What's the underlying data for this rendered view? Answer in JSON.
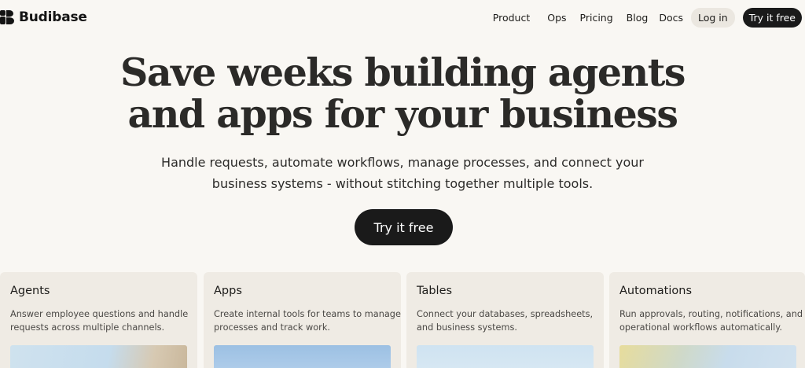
{
  "nav": {
    "brand": "Budibase",
    "brand_icon": "budibase-logo-icon",
    "links": {
      "product": "Product",
      "ops": "Ops",
      "pricing": "Pricing",
      "blog": "Blog",
      "docs": "Docs"
    },
    "login_label": "Log in",
    "try_label": "Try it free"
  },
  "hero": {
    "title_line1": "Save weeks building agents",
    "title_line2": "and apps for your business",
    "subtitle_line1": "Handle requests, automate workflows, manage processes, and connect your",
    "subtitle_line2": "business systems - without stitching together multiple tools.",
    "cta_label": "Try it free"
  },
  "cards": [
    {
      "title": "Agents",
      "desc_line1": "Answer employee questions and handle",
      "desc_line2": "requests across multiple channels."
    },
    {
      "title": "Apps",
      "desc_line1": "Create internal tools for teams to manage",
      "desc_line2": "processes and track work."
    },
    {
      "title": "Tables",
      "desc_line1": "Connect your databases, spreadsheets,",
      "desc_line2": "and business systems."
    },
    {
      "title": "Automations",
      "desc_line1": "Run approvals, routing, notifications, and",
      "desc_line2": "operational workflows automatically."
    }
  ],
  "colors": {
    "background": "#f9f7f3",
    "card_background": "#efebe4",
    "primary_button": "#1a1a1a",
    "login_button": "#ebe7e0"
  }
}
